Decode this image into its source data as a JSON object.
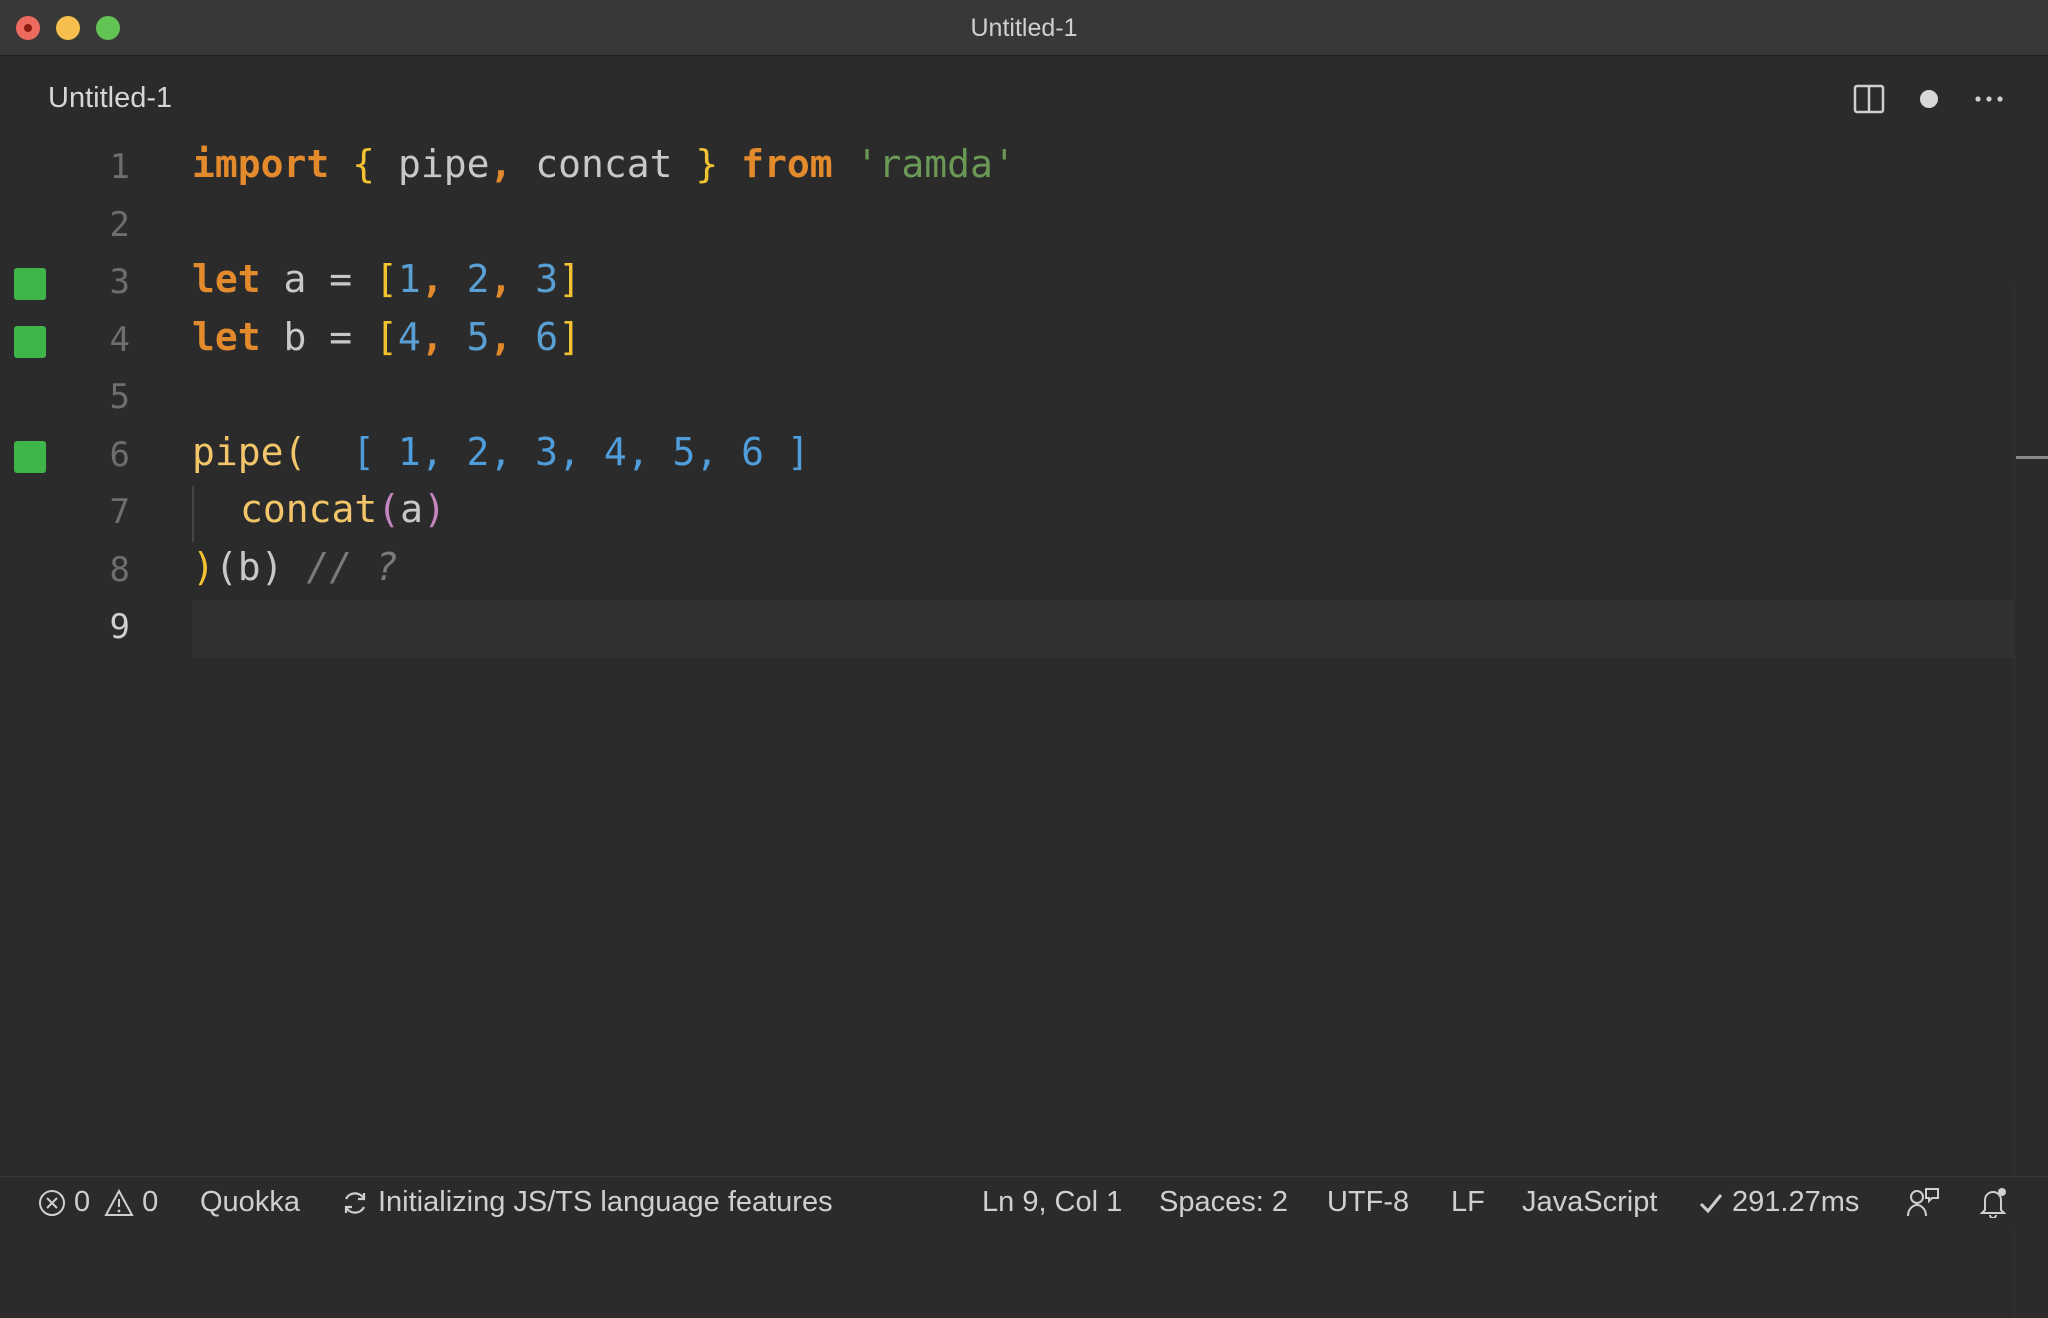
{
  "window": {
    "title": "Untitled-1"
  },
  "tab": {
    "label": "Untitled-1"
  },
  "icons": {
    "split": "split-editor-icon",
    "dirty": "unsaved-dot-icon",
    "more": "more-actions-icon",
    "error": "error-icon",
    "warning": "warning-icon",
    "sync": "sync-icon",
    "check": "check-icon",
    "feedback": "feedback-icon",
    "bell": "notifications-bell-icon"
  },
  "colors": {
    "keyword": "#e38a2c",
    "bracket": "#f2c230",
    "string": "#6a9955",
    "number": "#5a9fd4",
    "coverage": "#3fb44a"
  },
  "editor": {
    "lines": [
      {
        "n": "1",
        "covered": false
      },
      {
        "n": "2",
        "covered": false
      },
      {
        "n": "3",
        "covered": true
      },
      {
        "n": "4",
        "covered": true
      },
      {
        "n": "5",
        "covered": false
      },
      {
        "n": "6",
        "covered": true
      },
      {
        "n": "7",
        "covered": false
      },
      {
        "n": "8",
        "covered": false
      },
      {
        "n": "9",
        "covered": false
      }
    ],
    "tokens": {
      "import": "import",
      "lbrace": "{",
      "pipe_id": " pipe",
      "comma": ",",
      "concat_id": " concat ",
      "rbrace": "}",
      "from": "from",
      "module": "'ramda'",
      "let": "let",
      "a": " a = ",
      "b": " b = ",
      "lbrack": "[",
      "rbrack": "]",
      "n1": "1",
      "n2": "2",
      "n3": "3",
      "n4": "4",
      "n5": "5",
      "n6": "6",
      "sep": ", ",
      "pipe_call": "pipe(",
      "inline_value": "[ 1, 2, 3, 4, 5, 6 ]",
      "concat_call": "concat",
      "lparen": "(",
      "arg_a": "a",
      "rparen": ")",
      "close_paren": ")",
      "open_b": "(",
      "b_arg": "b",
      "close_b": ")",
      "comment": "// ?"
    }
  },
  "status": {
    "errors": "0",
    "warnings": "0",
    "quokka": "Quokka",
    "initializing": "Initializing JS/TS language features",
    "position": "Ln 9, Col 1",
    "spaces": "Spaces: 2",
    "encoding": "UTF-8",
    "eol": "LF",
    "language": "JavaScript",
    "timing": "291.27ms"
  }
}
